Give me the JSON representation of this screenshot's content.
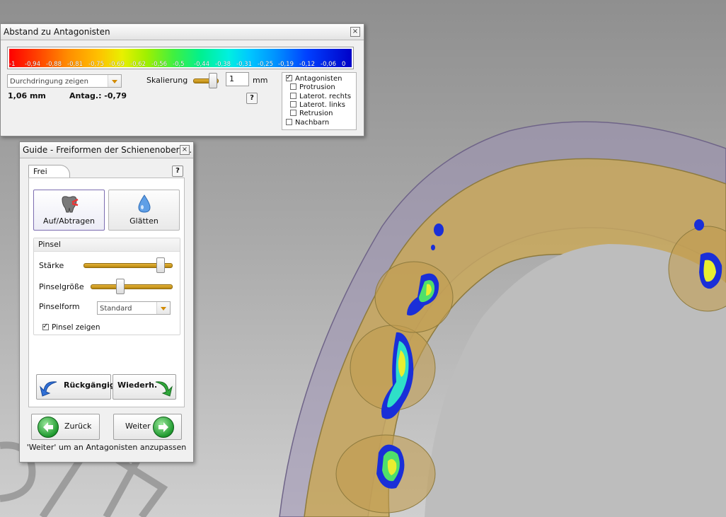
{
  "abstand": {
    "title": "Abstand zu Antagonisten",
    "scale_labels": [
      "-1",
      "-0,94",
      "-0,88",
      "-0,81",
      "-0,75",
      "-0,69",
      "-0,62",
      "-0,56",
      "-0,5",
      "-0,44",
      "-0,38",
      "-0,31",
      "-0,25",
      "-0,19",
      "-0,12",
      "-0,06",
      "0"
    ],
    "mode_select": "Durchdringung zeigen",
    "distance_value": "1,06 mm",
    "antag_value": "Antag.: -0,79",
    "skalierung_label": "Skalierung",
    "skalierung_value": "1",
    "skalierung_unit": "mm",
    "skalierung_level": 0.9,
    "help": "?",
    "checks": [
      {
        "label": "Antagonisten",
        "checked": true
      },
      {
        "label": "Protrusion",
        "checked": false
      },
      {
        "label": "Laterot. rechts",
        "checked": false
      },
      {
        "label": "Laterot. links",
        "checked": false
      },
      {
        "label": "Retrusion",
        "checked": false
      },
      {
        "label": "Nachbarn",
        "checked": false
      }
    ]
  },
  "guide": {
    "title": "Guide - Freiformen der Schienenobers...",
    "tab": "Frei",
    "help": "?",
    "tool_add": "Auf/Abtragen",
    "tool_smooth": "Glätten",
    "pinsel_header": "Pinsel",
    "staerke_label": "Stärke",
    "staerke_level": 0.9,
    "groesse_label": "Pinselgröße",
    "groesse_level": 0.35,
    "form_label": "Pinselform",
    "form_value": "Standard",
    "show_brush_label": "Pinsel zeigen",
    "show_brush_checked": true,
    "undo": "Rückgängig",
    "redo": "Wiederh.",
    "back": "Zurück",
    "next": "Weiter",
    "footer": "'Weiter' um an Antagonisten anzupassen"
  }
}
